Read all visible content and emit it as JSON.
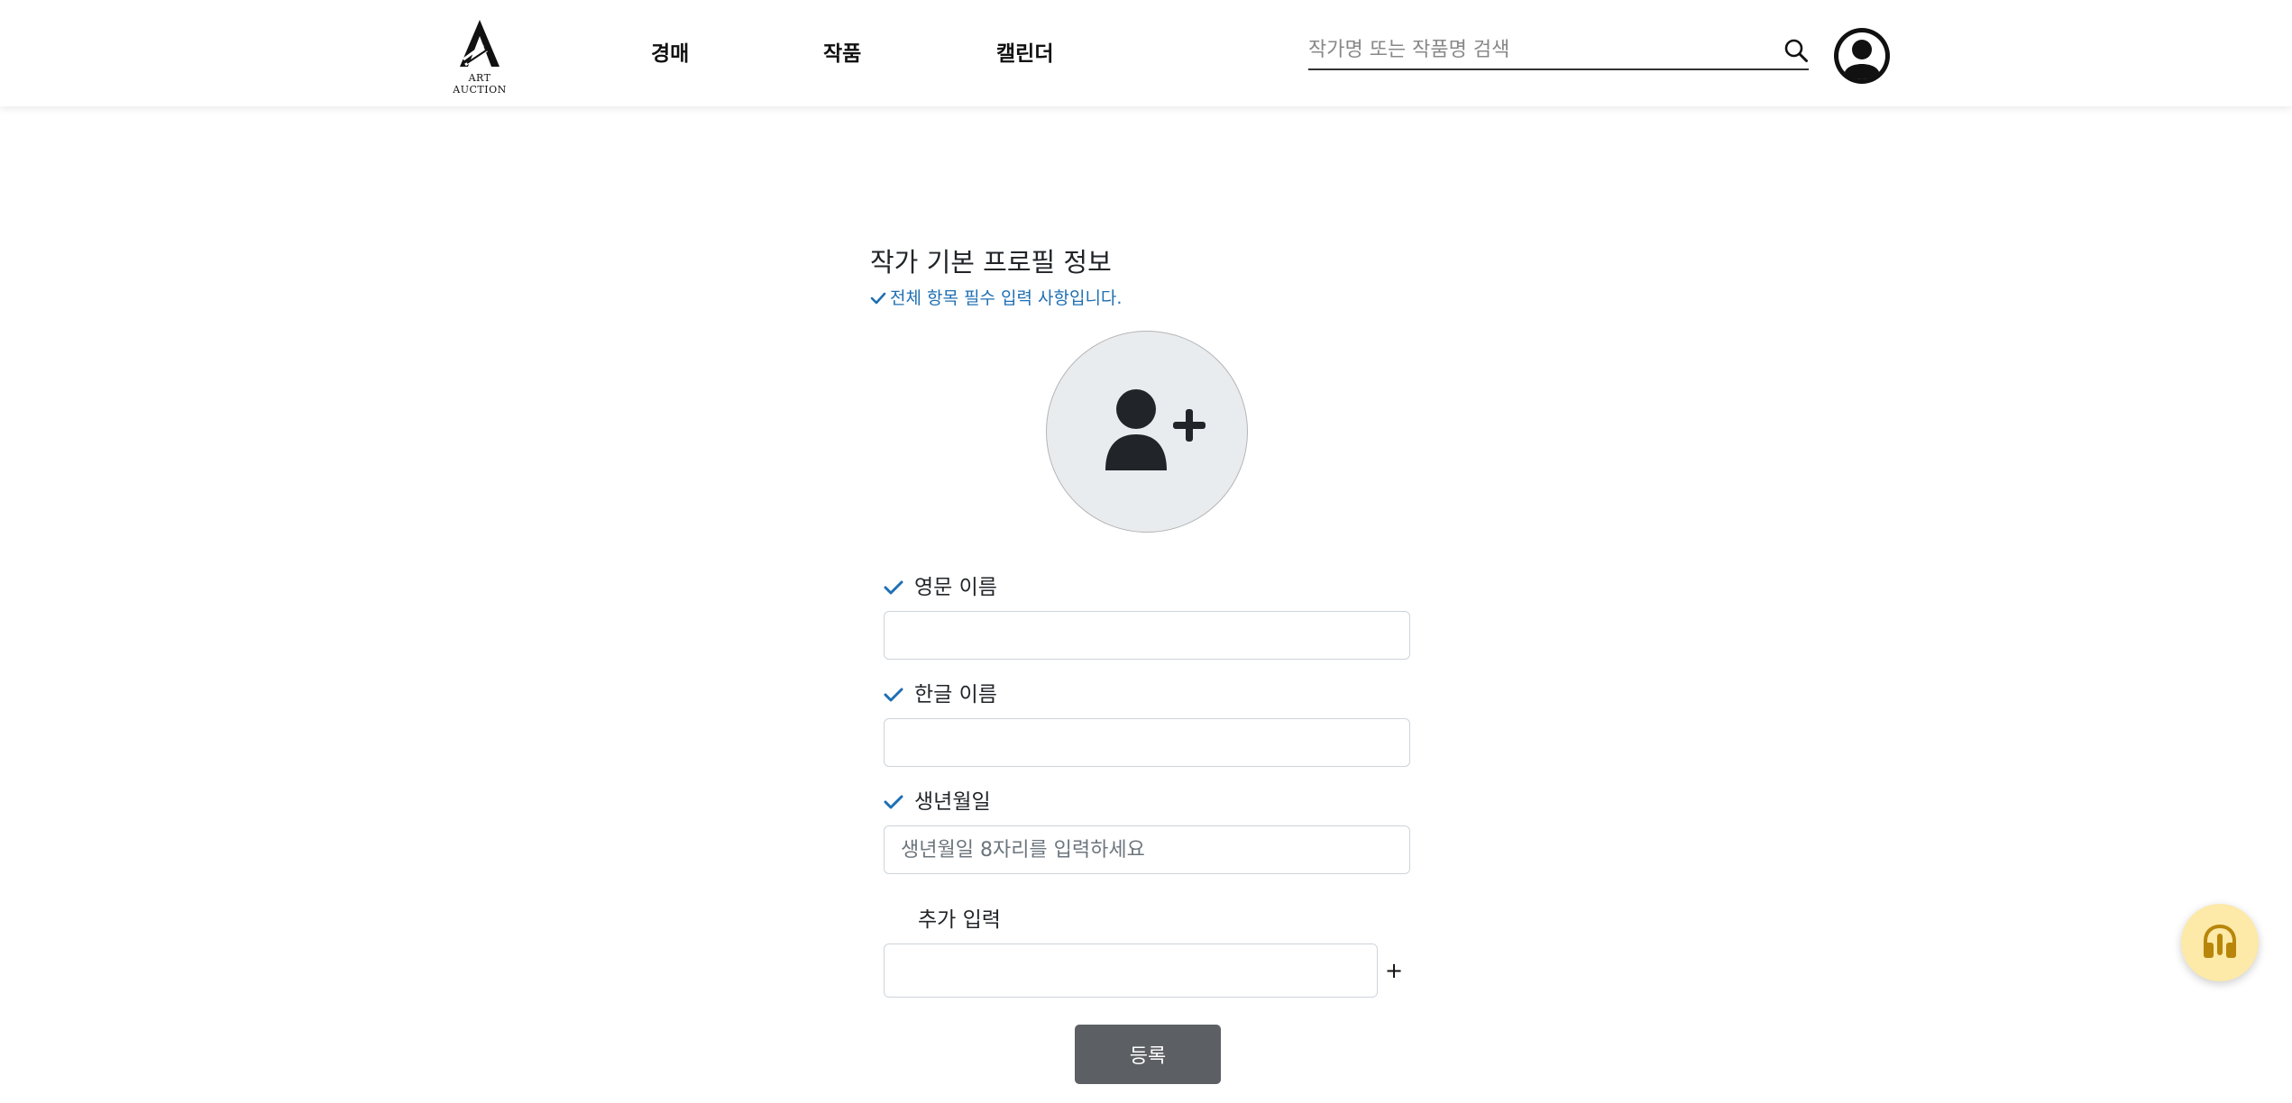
{
  "header": {
    "logo_text": "ART AUCTION",
    "nav": [
      {
        "label": "경매"
      },
      {
        "label": "작품"
      },
      {
        "label": "캘린더"
      }
    ],
    "search": {
      "placeholder": "작가명 또는 작품명 검색",
      "value": ""
    }
  },
  "form": {
    "title": "작가 기본 프로필 정보",
    "required_note": "전체 항목 필수 입력 사항입니다.",
    "fields": [
      {
        "label": "영문 이름",
        "value": "",
        "placeholder": ""
      },
      {
        "label": "한글 이름",
        "value": "",
        "placeholder": ""
      },
      {
        "label": "생년월일",
        "value": "",
        "placeholder": "생년월일 8자리를 입력하세요"
      }
    ],
    "extra": {
      "label": "추가 입력",
      "value": "",
      "add_symbol": "+"
    },
    "submit_label": "등록"
  },
  "icons": {
    "logo": "art-auction-logo",
    "search": "search-icon",
    "avatar": "user-circle-icon",
    "photo": "user-plus-icon",
    "check": "check-icon",
    "help": "headset-icon"
  },
  "colors": {
    "accent_blue": "#1f6fb3",
    "submit_bg": "#5c5f63",
    "photo_bg": "#e9ecef",
    "help_bg": "#fde9a8",
    "help_icon": "#b8860b"
  }
}
